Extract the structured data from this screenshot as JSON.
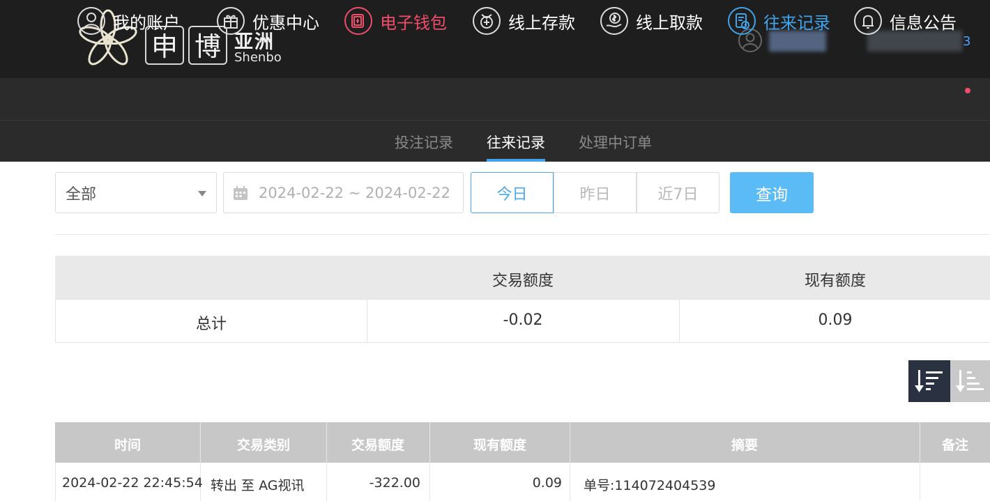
{
  "header": {
    "logo_box1": "申",
    "logo_box2": "博",
    "logo_cn": "亚洲",
    "logo_en": "Shenbo",
    "user_digit": "3"
  },
  "nav": {
    "items": [
      {
        "label": "我的账户",
        "icon": "user-circle-icon"
      },
      {
        "label": "优惠中心",
        "icon": "gift-icon"
      },
      {
        "label": "电子钱包",
        "icon": "wallet-icon"
      },
      {
        "label": "线上存款",
        "icon": "deposit-icon"
      },
      {
        "label": "线上取款",
        "icon": "withdraw-icon"
      },
      {
        "label": "往来记录",
        "icon": "record-icon"
      },
      {
        "label": "信息公告",
        "icon": "bell-icon"
      }
    ]
  },
  "subnav": {
    "items": [
      "投注记录",
      "往来记录",
      "处理中订单"
    ],
    "active": "往来记录"
  },
  "filters": {
    "type_select": "全部",
    "date_range": "2024-02-22 ~ 2024-02-22",
    "today": "今日",
    "yesterday": "昨日",
    "last7": "近7日",
    "search": "查询"
  },
  "summary": {
    "headers": [
      "",
      "交易额度",
      "现有额度"
    ],
    "row": [
      "总计",
      "-0.02",
      "0.09"
    ]
  },
  "records": {
    "headers": [
      "时间",
      "交易类别",
      "交易额度",
      "现有额度",
      "摘要",
      "备注"
    ],
    "rows": [
      [
        "2024-02-22 22:45:54",
        "转出 至 AG视讯",
        "-322.00",
        "0.09",
        "单号:114072404539",
        ""
      ]
    ]
  },
  "colors": {
    "header_bg": "#1e1e1e",
    "nav_bg": "#2b2b2b",
    "accent_blue": "#42a3ea",
    "accent_red": "#ef4d6a",
    "search_btn": "#5bbcf5"
  }
}
